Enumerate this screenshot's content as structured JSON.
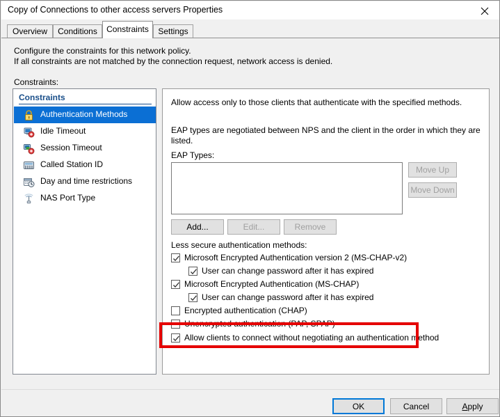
{
  "window": {
    "title": "Copy of Connections to other access servers Properties",
    "close_icon": "close-icon"
  },
  "tabs": [
    {
      "label": "Overview",
      "active": false
    },
    {
      "label": "Conditions",
      "active": false
    },
    {
      "label": "Constraints",
      "active": true
    },
    {
      "label": "Settings",
      "active": false
    }
  ],
  "page": {
    "description_line1": "Configure the constraints for this network policy.",
    "description_line2": "If all constraints are not matched by the connection request, network access is denied.",
    "constraints_label": "Constraints:"
  },
  "constraints_list": {
    "header": "Constraints",
    "items": [
      {
        "label": "Authentication Methods",
        "icon": "padlock-icon",
        "selected": true
      },
      {
        "label": "Idle Timeout",
        "icon": "idle-timeout-icon",
        "selected": false
      },
      {
        "label": "Session Timeout",
        "icon": "session-timeout-icon",
        "selected": false
      },
      {
        "label": "Called Station ID",
        "icon": "called-station-id-icon",
        "selected": false
      },
      {
        "label": "Day and time restrictions",
        "icon": "calendar-clock-icon",
        "selected": false
      },
      {
        "label": "NAS Port Type",
        "icon": "nas-port-type-icon",
        "selected": false
      }
    ]
  },
  "auth_methods": {
    "intro": "Allow access only to those clients that authenticate with the specified methods.",
    "eap_note_line1": "EAP types are negotiated between NPS and the client in the order in which they are",
    "eap_note_line2": "listed.",
    "eap_types_label": "EAP Types:",
    "eap_types_items": [],
    "move_up_label": "Move Up",
    "move_down_label": "Move Down",
    "add_label": "Add...",
    "edit_label": "Edit...",
    "remove_label": "Remove",
    "less_secure_label": "Less secure authentication methods:",
    "checkboxes": [
      {
        "label": "Microsoft Encrypted Authentication version 2 (MS-CHAP-v2)",
        "checked": true,
        "indent": 0
      },
      {
        "label": "User can change password after it has expired",
        "checked": true,
        "indent": 1
      },
      {
        "label": "Microsoft Encrypted Authentication (MS-CHAP)",
        "checked": true,
        "indent": 0
      },
      {
        "label": "User can change password after it has expired",
        "checked": true,
        "indent": 1
      },
      {
        "label": "Encrypted authentication (CHAP)",
        "checked": false,
        "indent": 0
      },
      {
        "label": "Unencrypted authentication (PAP, SPAP)",
        "checked": false,
        "indent": 0
      },
      {
        "label": "Allow clients to connect without negotiating an authentication method",
        "checked": true,
        "indent": 0
      }
    ]
  },
  "annotation": {
    "color": "#e50000",
    "target": "Allow clients to connect without negotiating an authentication method"
  },
  "footer": {
    "ok_label": "OK",
    "cancel_label": "Cancel",
    "apply_label": "Apply",
    "apply_accel": "A",
    "apply_rest": "pply"
  }
}
